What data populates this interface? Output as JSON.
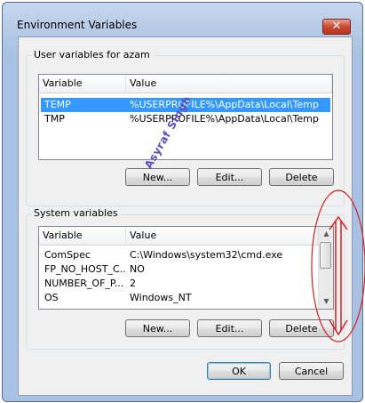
{
  "window": {
    "title": "Environment Variables",
    "close_glyph": "✕"
  },
  "user_vars": {
    "group_label": "User variables for azam",
    "columns": [
      "Variable",
      "Value"
    ],
    "rows": [
      {
        "variable": "TEMP",
        "value": "%USERPROFILE%\\AppData\\Local\\Temp"
      },
      {
        "variable": "TMP",
        "value": "%USERPROFILE%\\AppData\\Local\\Temp"
      }
    ],
    "buttons": {
      "new": "New...",
      "edit": "Edit...",
      "delete": "Delete"
    }
  },
  "system_vars": {
    "group_label": "System variables",
    "columns": [
      "Variable",
      "Value"
    ],
    "rows": [
      {
        "variable": "ComSpec",
        "value": "C:\\Windows\\system32\\cmd.exe"
      },
      {
        "variable": "FP_NO_HOST_C...",
        "value": "NO"
      },
      {
        "variable": "NUMBER_OF_P...",
        "value": "2"
      },
      {
        "variable": "OS",
        "value": "Windows_NT"
      }
    ],
    "buttons": {
      "new": "New...",
      "edit": "Edit...",
      "delete": "Delete"
    }
  },
  "footer": {
    "ok": "OK",
    "cancel": "Cancel"
  },
  "annotation": {
    "watermark": "Asyraf Singh",
    "color": "#d42020"
  },
  "colors": {
    "selection": "#3399ff",
    "window_frame": "#a9c1e3"
  }
}
